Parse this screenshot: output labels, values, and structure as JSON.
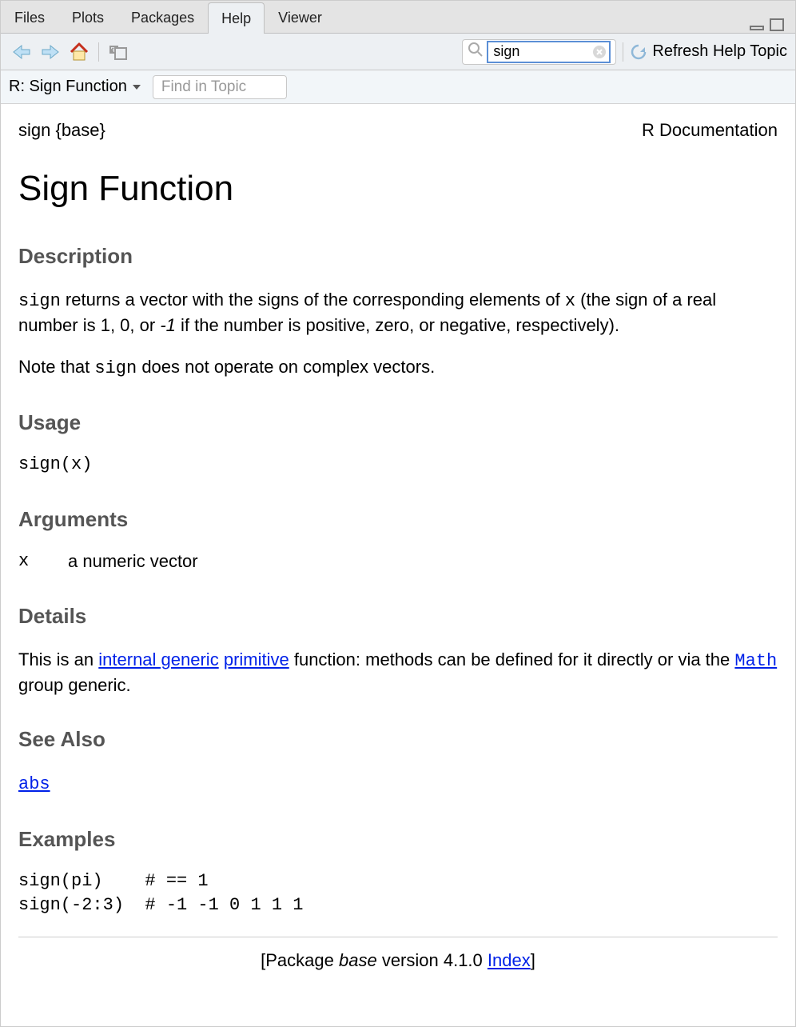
{
  "tabs": [
    "Files",
    "Plots",
    "Packages",
    "Help",
    "Viewer"
  ],
  "active_tab": "Help",
  "search_value": "sign",
  "refresh_label": "Refresh Help Topic",
  "sub_title": "R: Sign Function",
  "find_placeholder": "Find in Topic",
  "doc": {
    "topic": "sign {base}",
    "rdoc": "R Documentation",
    "h1": "Sign Function",
    "sec_description": "Description",
    "desc_code1": "sign",
    "desc_text1": " returns a vector with the signs of the corresponding elements of ",
    "desc_code2": "x",
    "desc_text2": " (the sign of a real number is 1, 0, or ",
    "desc_italic": "-1",
    "desc_text3": " if the number is positive, zero, or negative, respectively).",
    "desc_p2a": "Note that ",
    "desc_p2code": "sign",
    "desc_p2b": " does not operate on complex vectors.",
    "sec_usage": "Usage",
    "usage_code": "sign(x)",
    "sec_arguments": "Arguments",
    "arg_name": "x",
    "arg_desc": "a numeric vector",
    "sec_details": "Details",
    "details_a": "This is an ",
    "details_link1": "internal generic",
    "details_space": " ",
    "details_link2": "primitive",
    "details_b": " function: methods can be defined for it directly or via the ",
    "details_link3": "Math",
    "details_c": " group generic.",
    "sec_seealso": "See Also",
    "seealso_link": "abs",
    "sec_examples": "Examples",
    "examples_code": "sign(pi)    # == 1\nsign(-2:3)  # -1 -1 0 1 1 1",
    "footer_a": "[Package ",
    "footer_pkg": "base",
    "footer_b": " version 4.1.0 ",
    "footer_link": "Index",
    "footer_c": "]"
  }
}
